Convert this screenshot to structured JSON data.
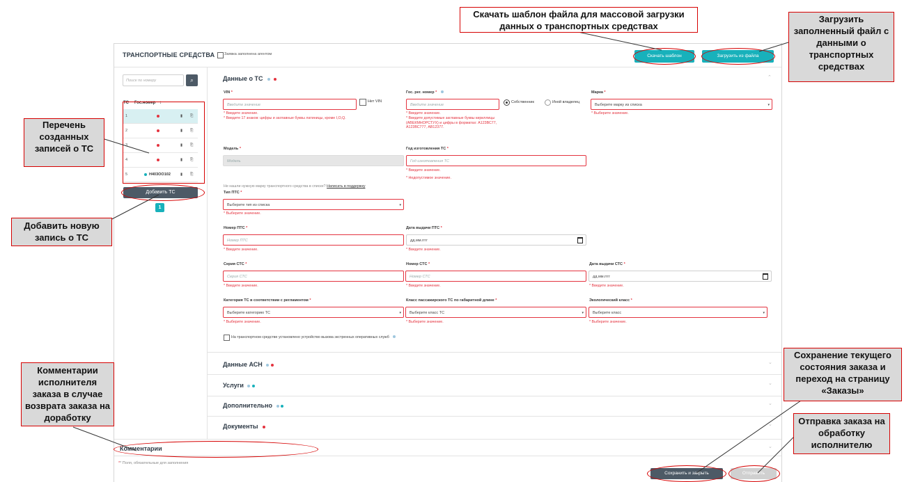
{
  "header": {
    "title": "ТРАНСПОРТНЫЕ СРЕДСТВА",
    "agent_checkbox_label": "Заявка заполнена агентом",
    "download_template": "Скачать шаблон",
    "upload_file": "Загрузить из файла"
  },
  "sidebar": {
    "search_placeholder": "Поиск по номеру",
    "col_tc": "ТС",
    "col_num": "Гос.номер",
    "rows": [
      {
        "n": "1",
        "plate": ""
      },
      {
        "n": "2",
        "plate": ""
      },
      {
        "n": "3",
        "plate": ""
      },
      {
        "n": "4",
        "plate": ""
      },
      {
        "n": "5",
        "plate": "Н403ОО102"
      }
    ],
    "add_button": "Добавить ТС",
    "page": "1"
  },
  "form": {
    "section_title": "Данные о ТС",
    "vin_label": "VIN",
    "vin_placeholder": "Введите значение",
    "no_vin": "Нет VIN",
    "vin_err1": "* Введите значение.",
    "vin_err2": "* Введите 17 знаков: цифры и заглавные буквы латиницы, кроме I,O,Q.",
    "reg_label": "Гос. рег. номер",
    "reg_placeholder": "Введите значение",
    "reg_err1": "* Введите значение.",
    "reg_err2": "* Введите допустимые заглавные буквы кириллицы (АВЕКМНОРСТУХ) и цифры в форматах: А123ВС77, А123ВС777, АВ12377.",
    "owner_self": "Собственник",
    "owner_other": "Иной владелец",
    "brand_label": "Марка",
    "brand_placeholder": "Выберите марку из списка",
    "brand_err": "* Выберите значение.",
    "model_label": "Модель",
    "model_placeholder": "Модель",
    "year_label": "Год изготовления ТС",
    "year_placeholder": "Год изготовления ТС",
    "year_err1": "* Введите значение.",
    "year_err2": "* Недопустимое значение.",
    "not_found": "Не нашли нужную марку транспортного средства в списке?",
    "support_link": "Написать в поддержку",
    "pts_type_label": "Тип ПТС",
    "pts_type_placeholder": "Выберите тип из списка",
    "pts_type_err": "* Выберите значение.",
    "pts_num_label": "Номер ПТС",
    "pts_num_placeholder": "Номер ПТС",
    "pts_num_err": "* Введите значение.",
    "pts_date_label": "Дата выдачи ПТС",
    "pts_date_placeholder": "дд.мм.гггг",
    "pts_date_err": "* Введите значение.",
    "sts_series_label": "Серия СТС",
    "sts_series_placeholder": "Серия СТС",
    "sts_series_err": "* Введите значение.",
    "sts_num_label": "Номер СТС",
    "sts_num_placeholder": "Номер СТС",
    "sts_num_err": "* Введите значение.",
    "sts_date_label": "Дата выдачи СТС",
    "sts_date_placeholder": "дд.мм.гггг",
    "sts_date_err": "* Введите значение.",
    "cat_label": "Категория ТС в соответствии с регламентом",
    "cat_placeholder": "Выберите категорию ТС",
    "cat_err": "* Выберите значение.",
    "class_label": "Класс пассажирского ТС по габаритной длине",
    "class_placeholder": "Выберите класс ТС",
    "class_err": "* Выберите значение.",
    "eco_label": "Экологический класс",
    "eco_placeholder": "Выберите класс",
    "eco_err": "* Выберите значение.",
    "emergency_label": "На транспортном средстве установлено устройство вызова экстренных оперативных служб"
  },
  "sections": {
    "ash": "Данные АСН",
    "services": "Услуги",
    "additional": "Дополнительно",
    "documents": "Документы",
    "comments": "Комментарии"
  },
  "footer": {
    "required_note": "* Поля, обязательные для заполнения",
    "save_close": "Сохранить и закрыть",
    "send": "Отправить"
  },
  "callouts": {
    "template": "Скачать шаблон файла для массовой загрузки данных о транспортных средствах",
    "upload": "Загрузить заполненный файл с данными о транспортных средствах",
    "list": "Перечень созданных записей о ТС",
    "add": "Добавить новую запись о ТС",
    "comments": "Комментарии исполнителя заказа в случае возврата заказа на доработку",
    "save": "Сохранение текущего состояния заказа и переход на страницу «Заказы»",
    "send": "Отправка заказа на обработку исполнителю"
  },
  "colors": {
    "accent": "#18b1bb",
    "dark": "#4d5a66",
    "error": "#e4333f",
    "callout_border": "#d60000"
  }
}
